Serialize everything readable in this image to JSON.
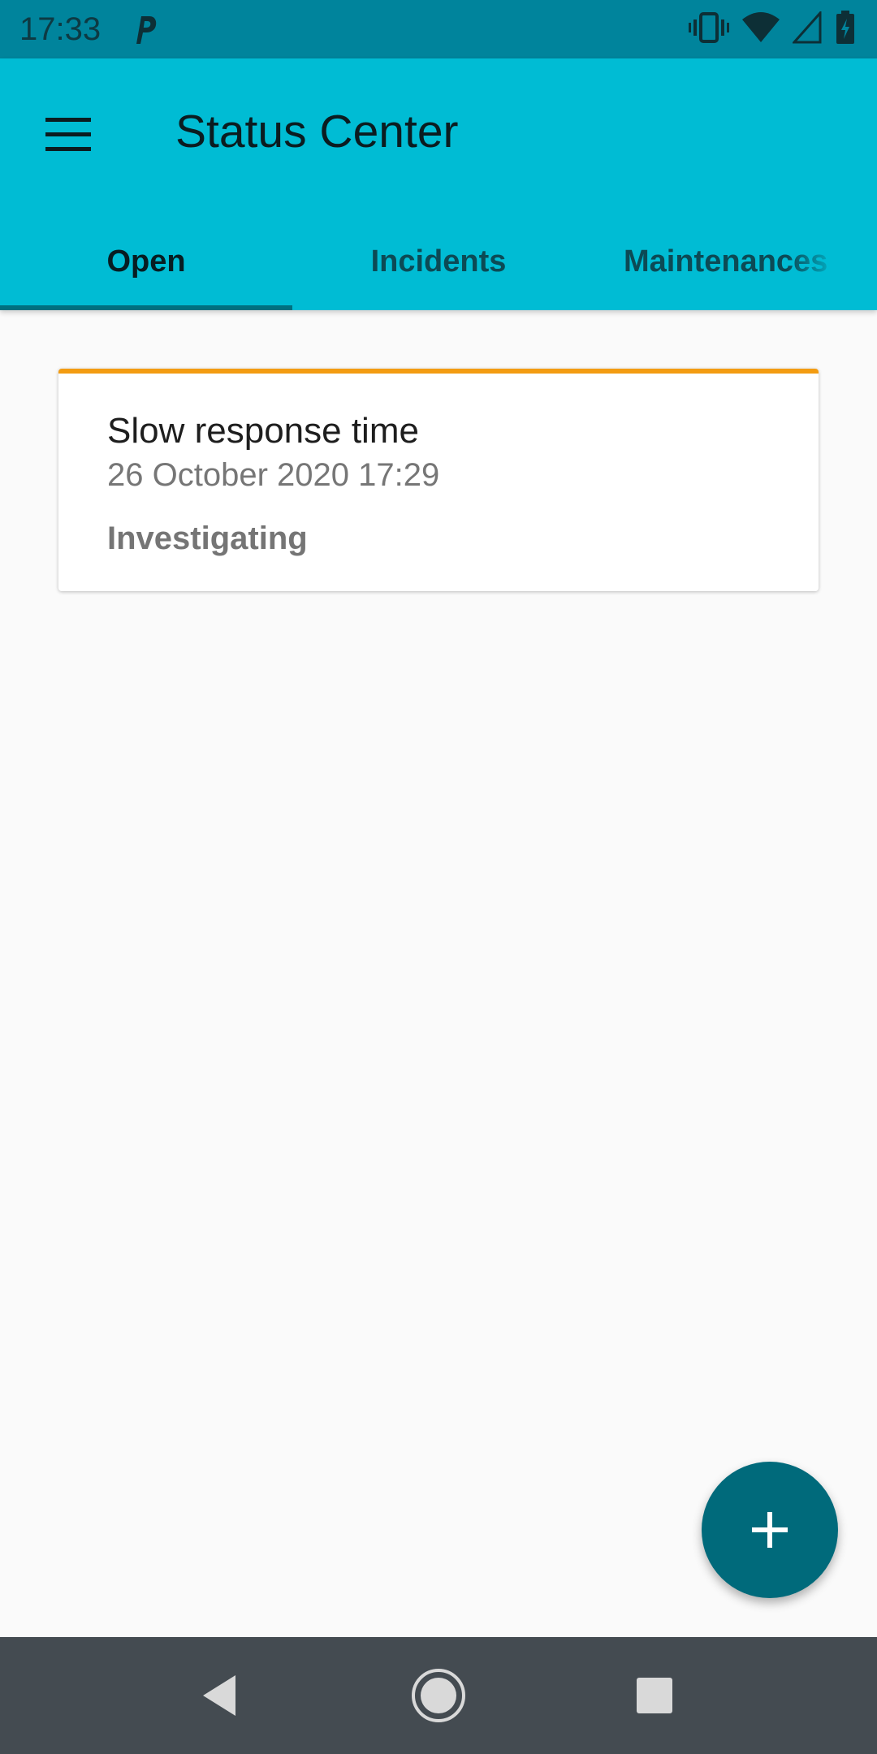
{
  "status_bar": {
    "time": "17:33",
    "icons": [
      "p-app-icon",
      "vibrate-icon",
      "wifi-icon",
      "signal-icon",
      "battery-icon"
    ]
  },
  "app_bar": {
    "title": "Status Center",
    "menu_icon": "menu-icon",
    "tabs": [
      {
        "label": "Open",
        "active": true
      },
      {
        "label": "Incidents",
        "active": false
      },
      {
        "label": "Maintenances",
        "active": false
      }
    ]
  },
  "cards": [
    {
      "title": "Slow response time",
      "date": "26 October 2020 17:29",
      "status": "Investigating",
      "accent_color": "#f39c12"
    }
  ],
  "fab": {
    "icon": "plus-icon",
    "color": "#006a7b"
  },
  "nav_bar": {
    "icons": [
      "back-icon",
      "home-icon",
      "recents-icon"
    ]
  },
  "colors": {
    "status_bar": "#00849c",
    "app_bar": "#00bcd4",
    "tab_indicator": "#00707f",
    "background": "#fafafa",
    "nav_bar": "#444b51"
  }
}
